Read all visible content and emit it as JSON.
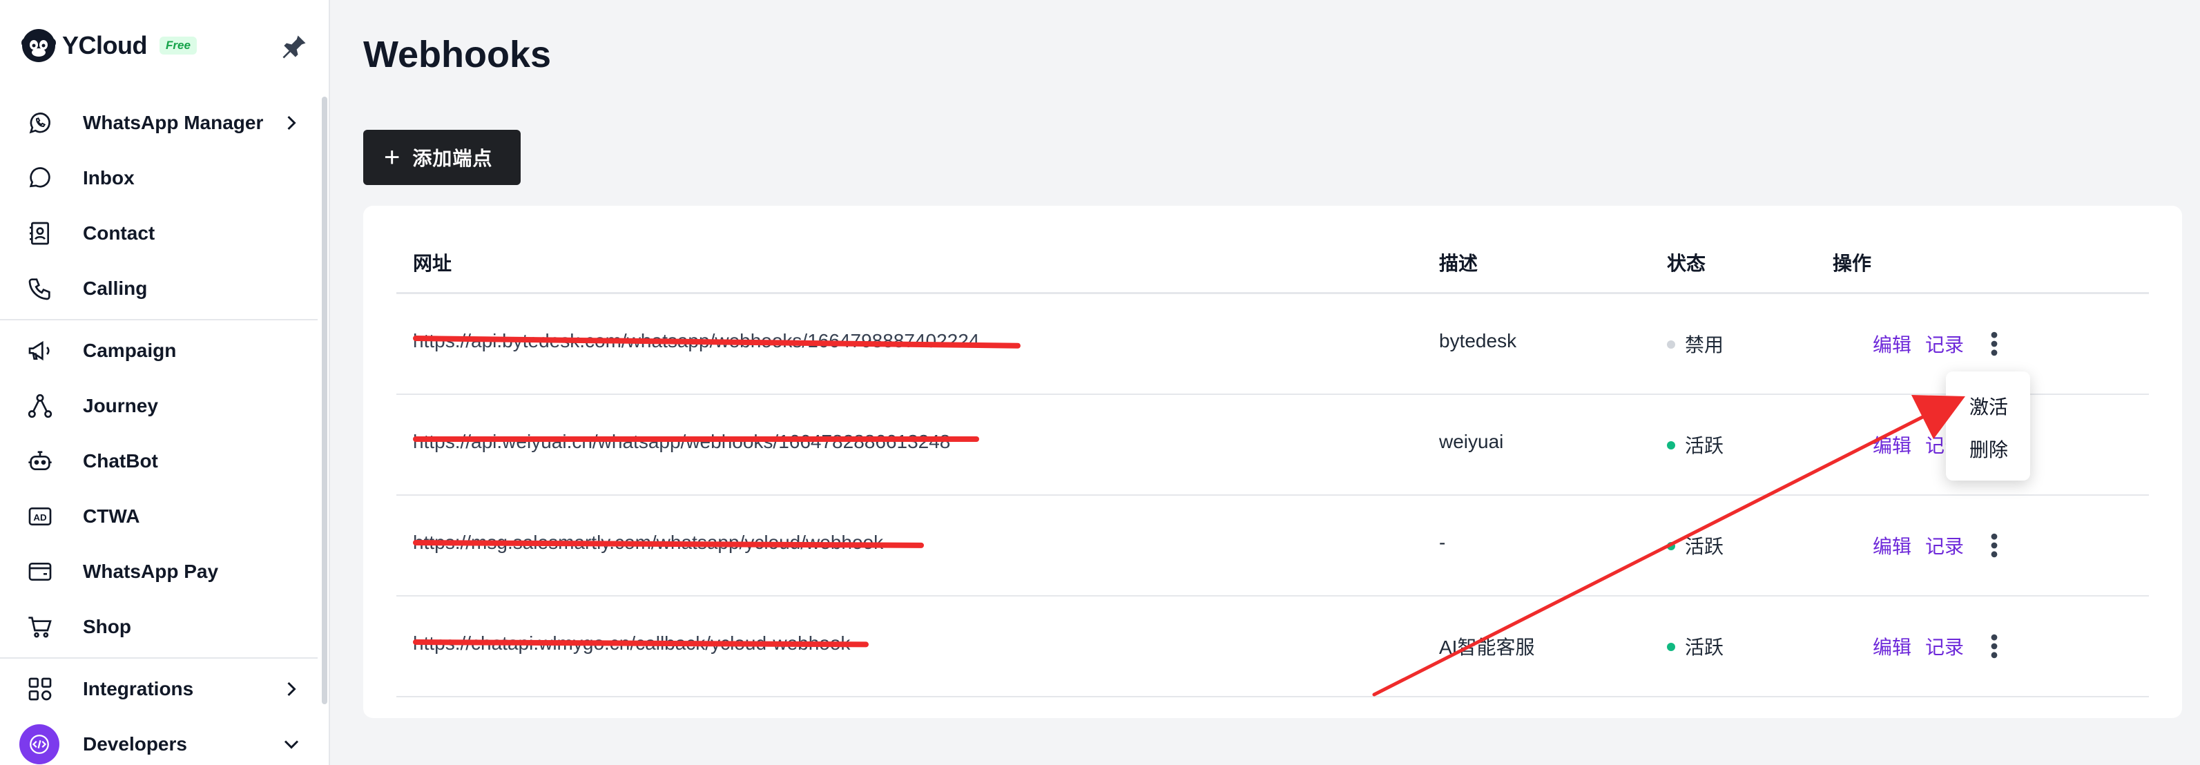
{
  "brand": {
    "name": "YCloud",
    "badge": "Free"
  },
  "sidebar": {
    "items": [
      {
        "label": "WhatsApp Manager",
        "icon": "whatsapp-icon",
        "has_caret": true
      },
      {
        "label": "Inbox",
        "icon": "chat-bubble-icon"
      },
      {
        "label": "Contact",
        "icon": "contact-icon"
      },
      {
        "label": "Calling",
        "icon": "phone-icon"
      },
      {
        "label": "Campaign",
        "icon": "megaphone-icon"
      },
      {
        "label": "Journey",
        "icon": "journey-icon"
      },
      {
        "label": "ChatBot",
        "icon": "robot-icon"
      },
      {
        "label": "CTWA",
        "icon": "ad-icon"
      },
      {
        "label": "WhatsApp Pay",
        "icon": "wallet-icon"
      },
      {
        "label": "Shop",
        "icon": "cart-icon"
      },
      {
        "label": "Integrations",
        "icon": "grid-icon",
        "has_caret": true
      },
      {
        "label": "Developers",
        "icon": "code-icon",
        "has_caret": true,
        "expanded": true
      }
    ]
  },
  "main": {
    "title": "Webhooks",
    "add_button": "添加端点",
    "table": {
      "headers": {
        "url": "网址",
        "description": "描述",
        "status": "状态",
        "actions": "操作"
      },
      "rows": [
        {
          "url": "https://api.bytedesk.com/whatsapp/webhooks/1664798887402224",
          "description": "bytedesk",
          "status": "禁用",
          "status_color": "#d1d5db"
        },
        {
          "url": "https://api.weiyuai.cn/whatsapp/webhooks/1664782886613248",
          "description": "weiyuai",
          "status": "活跃",
          "status_color": "#10b981"
        },
        {
          "url": "https://msg.salesmartly.com/whatsapp/ycloud/webhook",
          "description": "-",
          "status": "活跃",
          "status_color": "#10b981"
        },
        {
          "url": "https://chatapi.wlmygo.cn/callback/ycloud-webhook",
          "description": "AI智能客服",
          "status": "活跃",
          "status_color": "#10b981"
        }
      ],
      "edit_label": "编辑",
      "log_label": "记录"
    },
    "dropdown": {
      "activate": "激活",
      "delete": "删除"
    }
  },
  "colors": {
    "accent": "#6d28d9",
    "annotation": "#ef2b2b",
    "button_bg": "#1f2125"
  }
}
